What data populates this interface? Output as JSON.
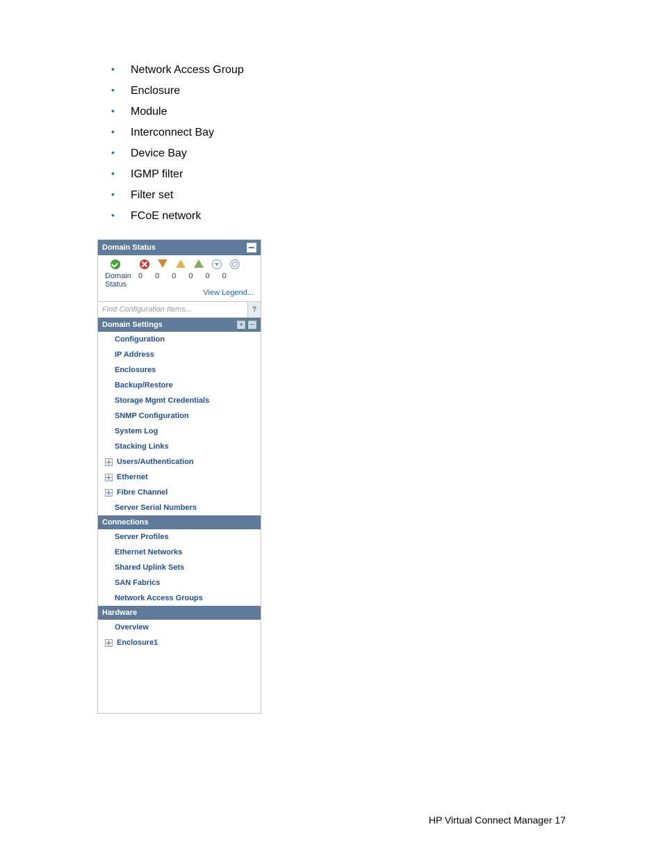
{
  "doc_list": [
    "Network Access Group",
    "Enclosure",
    "Module",
    "Interconnect Bay",
    "Device Bay",
    "IGMP filter",
    "Filter set",
    "FCoE network"
  ],
  "panel": {
    "domain_status": {
      "title": "Domain Status",
      "row_label": "Domain Status",
      "counts": [
        "0",
        "0",
        "0",
        "0",
        "0",
        "0"
      ],
      "legend_link": "View Legend..."
    },
    "search": {
      "placeholder": "Find Configuration Items...",
      "help": "?"
    },
    "domain_settings": {
      "title": "Domain Settings",
      "items": [
        "Configuration",
        "IP Address",
        "Enclosures",
        "Backup/Restore",
        "Storage Mgmt Credentials",
        "SNMP Configuration",
        "System Log",
        "Stacking Links"
      ],
      "expandables": [
        "Users/Authentication",
        "Ethernet",
        "Fibre Channel"
      ],
      "tail_item": "Server Serial Numbers"
    },
    "connections": {
      "title": "Connections",
      "items": [
        "Server Profiles",
        "Ethernet Networks",
        "Shared Uplink Sets",
        "SAN Fabrics",
        "Network Access Groups"
      ]
    },
    "hardware": {
      "title": "Hardware",
      "overview": "Overview",
      "enclosure": "Enclosure1"
    }
  },
  "footer": {
    "product": "HP Virtual Connect Manager",
    "page_sep": "    ",
    "page_no": "17"
  }
}
